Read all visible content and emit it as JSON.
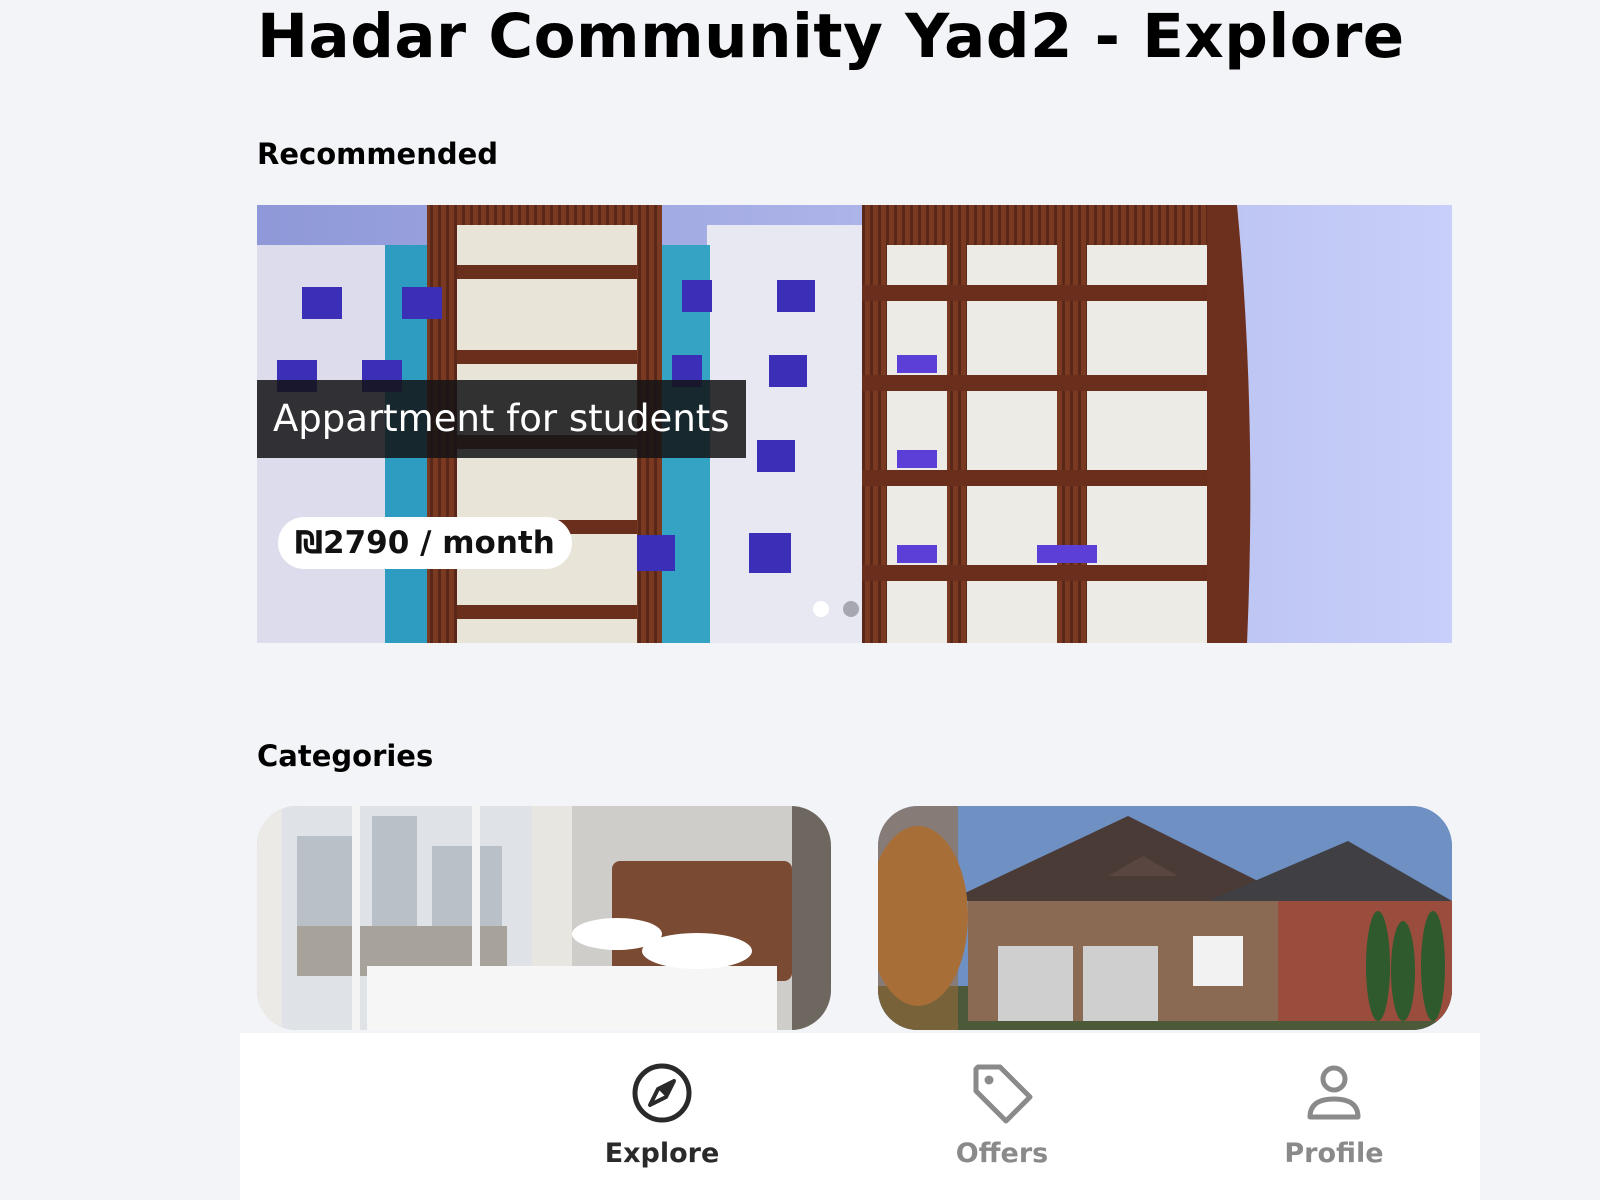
{
  "header": {
    "title": "Hadar Community Yad2 - Explore"
  },
  "recommended": {
    "heading": "Recommended",
    "slides": [
      {
        "title": "Appartment for students",
        "price": "₪2790 / month"
      }
    ],
    "slide_count": 2,
    "active_slide": 1
  },
  "categories": {
    "heading": "Categories",
    "cards": [
      {
        "icon": "bedroom-photo"
      },
      {
        "icon": "house-photo"
      }
    ]
  },
  "nav": {
    "items": [
      {
        "label": "Explore",
        "icon": "compass-icon",
        "active": true
      },
      {
        "label": "Offers",
        "icon": "tag-icon",
        "active": false
      },
      {
        "label": "Profile",
        "icon": "user-icon",
        "active": false
      }
    ],
    "active_color": "#2a2a2a",
    "inactive_color": "#8a8a8a"
  }
}
